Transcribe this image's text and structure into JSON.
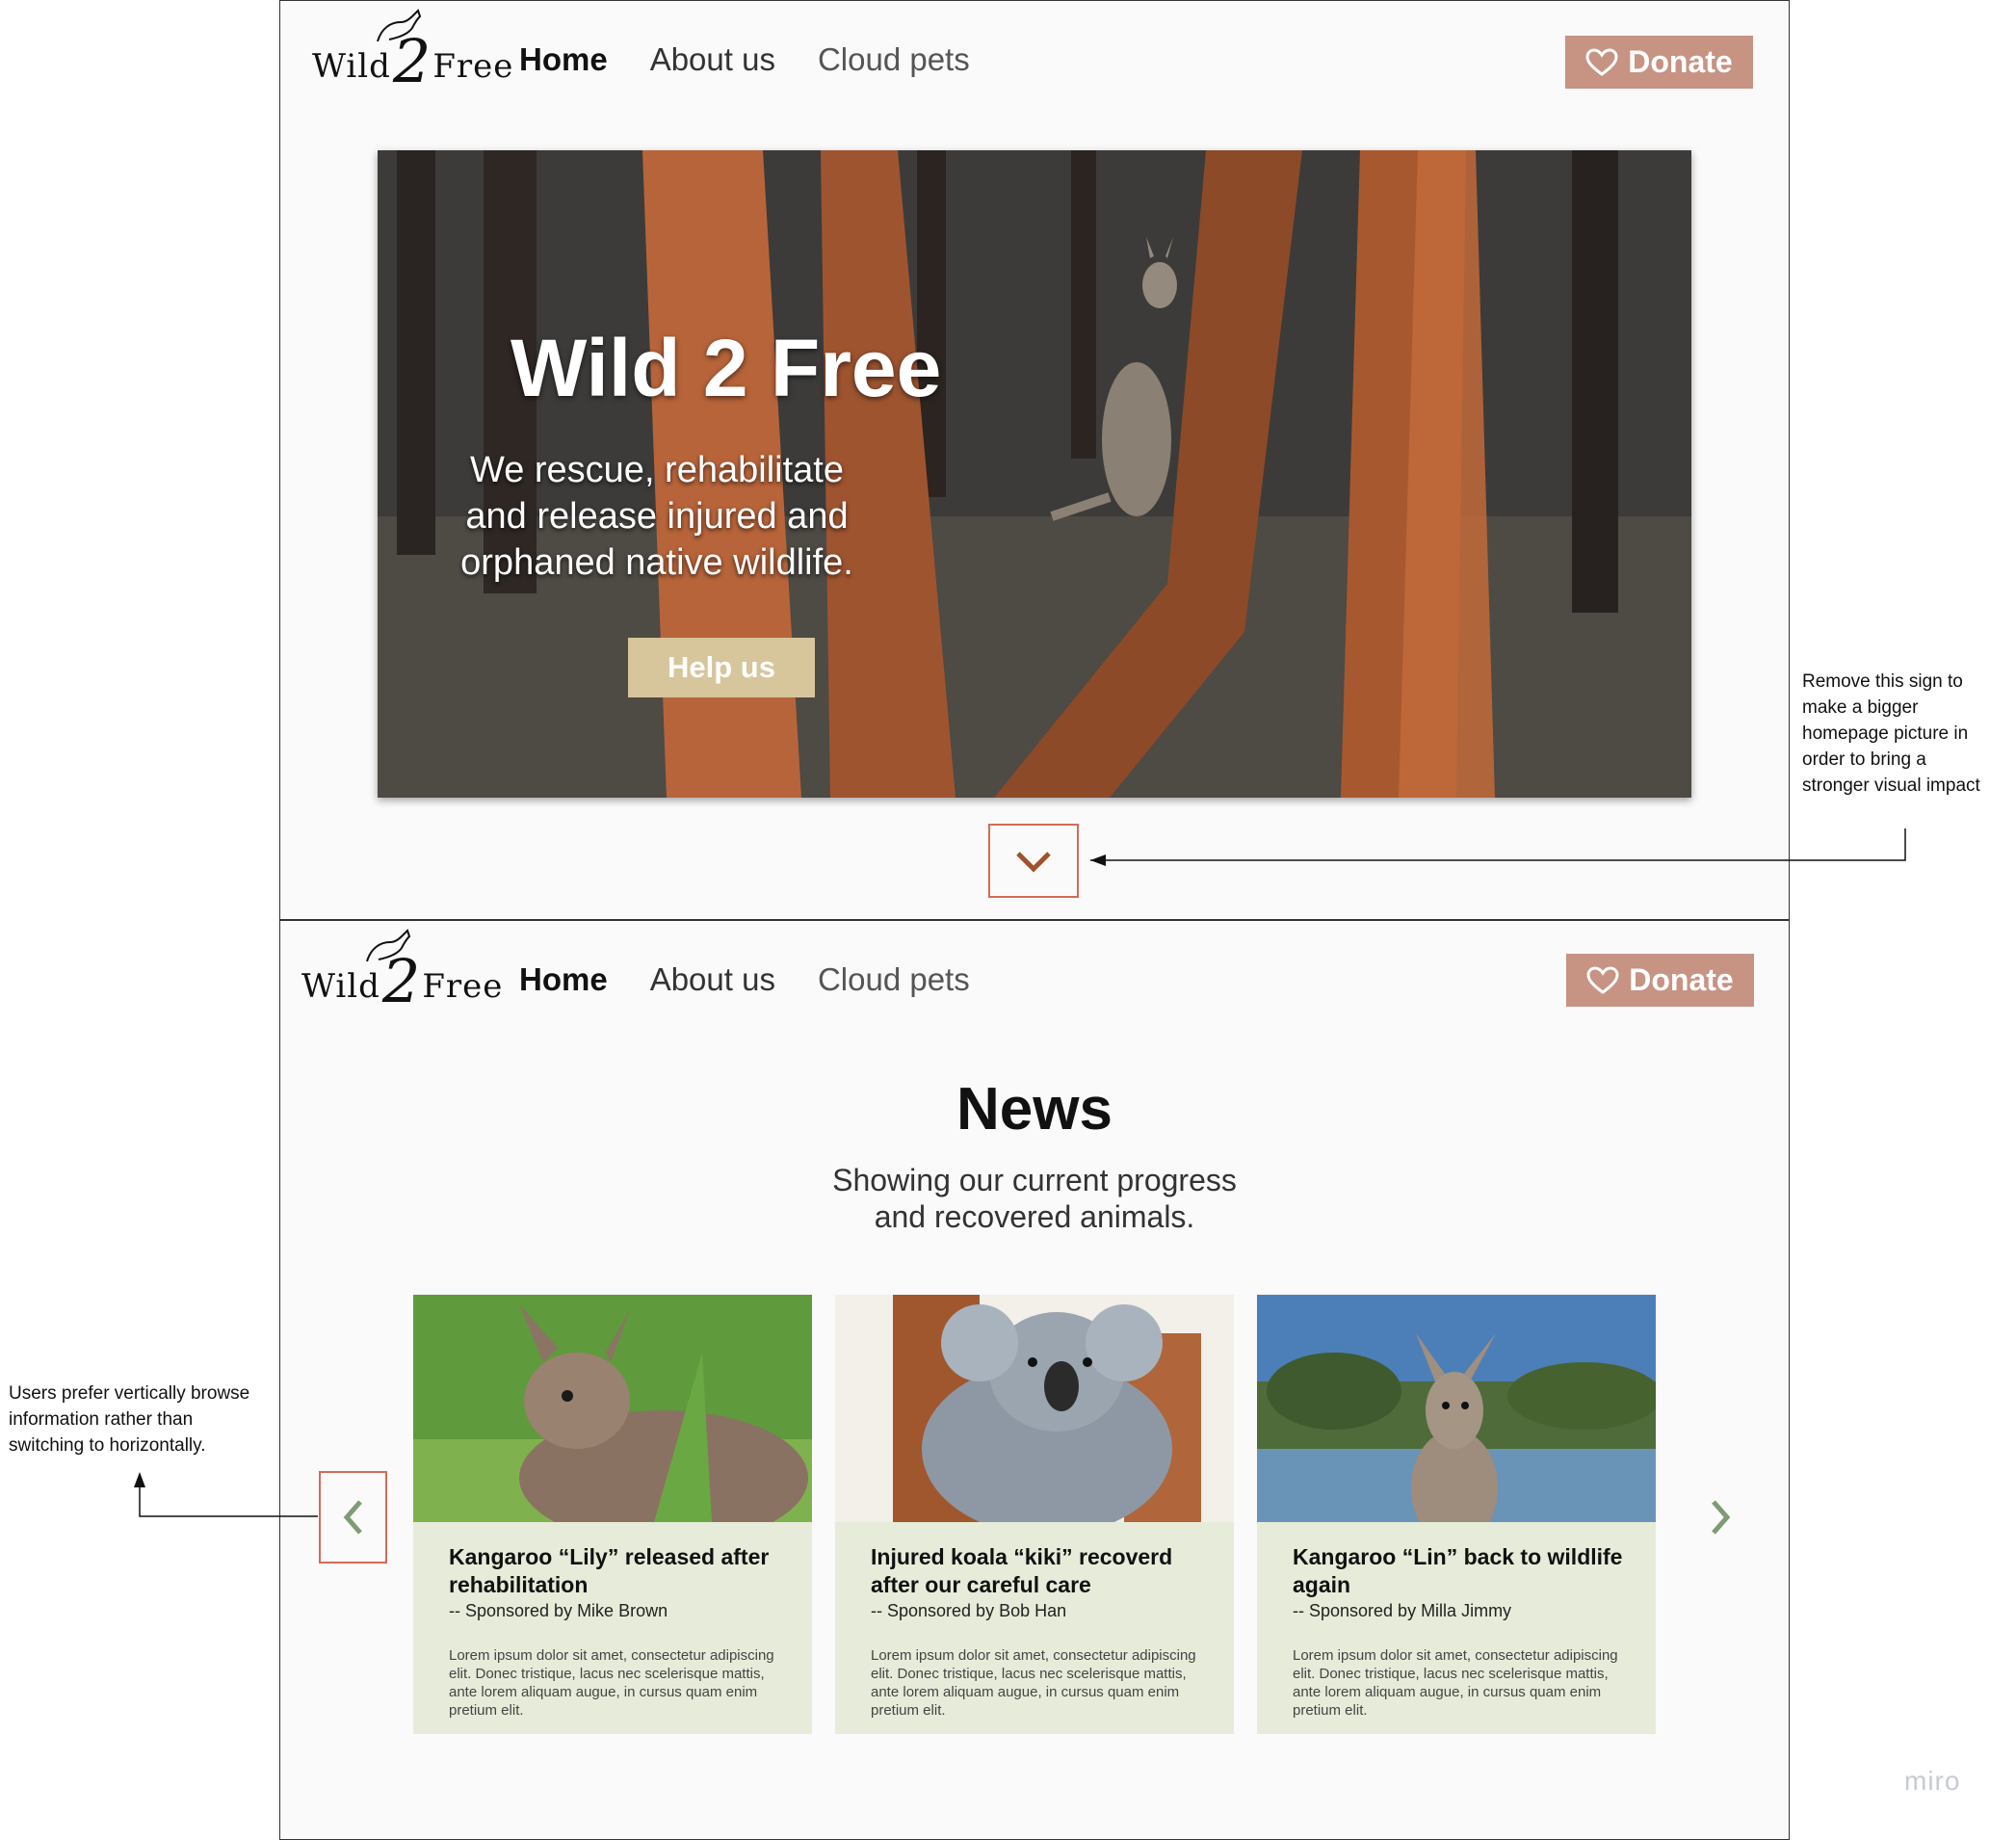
{
  "brand": {
    "logo_left": "Wild",
    "logo_mid": "2",
    "logo_right": "Free"
  },
  "nav": {
    "home": "Home",
    "about": "About us",
    "cloud_pets": "Cloud pets",
    "donate": "Donate"
  },
  "hero": {
    "title": "Wild 2 Free",
    "subtitle": "We rescue, rehabilitate and release injured and orphaned native wildlife.",
    "cta": "Help us"
  },
  "news": {
    "title": "News",
    "subtitle_line1": "Showing our current progress",
    "subtitle_line2": "and recovered animals.",
    "cards": [
      {
        "title": "Kangaroo “Lily” released after rehabilitation",
        "sponsor": "-- Sponsored by Mike Brown",
        "body": "Lorem ipsum dolor sit amet, consectetur adipiscing elit. Donec tristique, lacus nec scelerisque mattis, ante lorem aliquam augue, in cursus quam enim pretium elit."
      },
      {
        "title": "Injured koala “kiki” recoverd after our careful care",
        "sponsor": "-- Sponsored by Bob Han",
        "body": "Lorem ipsum dolor sit amet, consectetur adipiscing elit. Donec tristique, lacus nec scelerisque mattis, ante lorem aliquam augue, in cursus quam enim pretium elit."
      },
      {
        "title": "Kangaroo “Lin” back to wildlife again",
        "sponsor": "-- Sponsored by Milla Jimmy",
        "body": "Lorem ipsum dolor sit amet, consectetur adipiscing elit. Donec tristique, lacus nec scelerisque mattis, ante lorem aliquam augue, in cursus quam enim pretium elit."
      }
    ]
  },
  "annotations": {
    "right_note": [
      "Remove this sign to",
      "make a bigger",
      "homepage picture in",
      "order to bring a",
      "stronger visual impact"
    ],
    "left_note": [
      "Users prefer vertically browse",
      "information rather than",
      "switching to horizontally."
    ]
  },
  "watermark": "miro",
  "colors": {
    "donate": "#c79383",
    "help": "#d7c59b",
    "card_bg": "#e6ecd9",
    "highlight_box": "#d46b58",
    "arrow_green": "#7e9c74"
  },
  "icons": [
    "heart-icon",
    "chevron-down-icon",
    "chevron-left-icon",
    "chevron-right-icon",
    "kangaroo-logo-icon"
  ]
}
